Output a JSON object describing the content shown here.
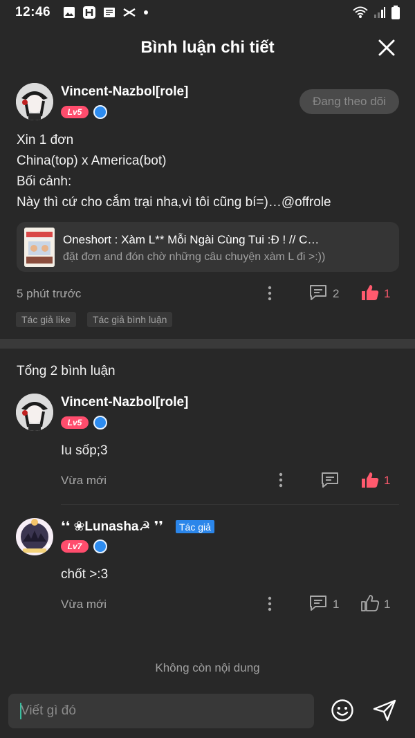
{
  "status_bar": {
    "time": "12:46"
  },
  "header": {
    "title": "Bình luận chi tiết"
  },
  "post": {
    "author": "Vincent-Nazbol[role]",
    "level": "Lv5",
    "follow_label": "Đang theo dõi",
    "text_lines": [
      "Xin 1 đơn",
      "China(top) x America(bot)",
      "Bối cảnh:",
      "Này thì cứ cho cắm trại nha,vì tôi cũng bí=)…@offrole"
    ],
    "linked_story": {
      "title": "Oneshort : Xàm L** Mỗi Ngài Cùng Tui :Đ ! // C…",
      "subtitle": "đặt đơn and đón chờ những câu chuyện xàm L đi >:))"
    },
    "time": "5 phút trước",
    "comment_count": "2",
    "like_count": "1",
    "tags": [
      "Tác giả like",
      "Tác giả bình luận"
    ]
  },
  "comments_section": {
    "total_label": "Tổng 2 bình luận",
    "comments": [
      {
        "author": "Vincent-Nazbol[role]",
        "level": "Lv5",
        "text": "Iu sốp;3",
        "time": "Vừa mới",
        "like_count": "1"
      },
      {
        "author": "❛❛ ❀Lunasha☭ ❜❜",
        "author_badge": "Tác giả",
        "level": "Lv7",
        "text": "chốt >:3",
        "time": "Vừa mới",
        "reply_count": "1",
        "like_count": "1"
      }
    ],
    "end_label": "Không còn nội dung"
  },
  "input": {
    "placeholder": "Viết gì đó"
  },
  "colors": {
    "accent_red": "#ff5a6e",
    "level_badge": "#ff4d6d",
    "author_tag": "#2b86ea",
    "background": "#282828"
  }
}
